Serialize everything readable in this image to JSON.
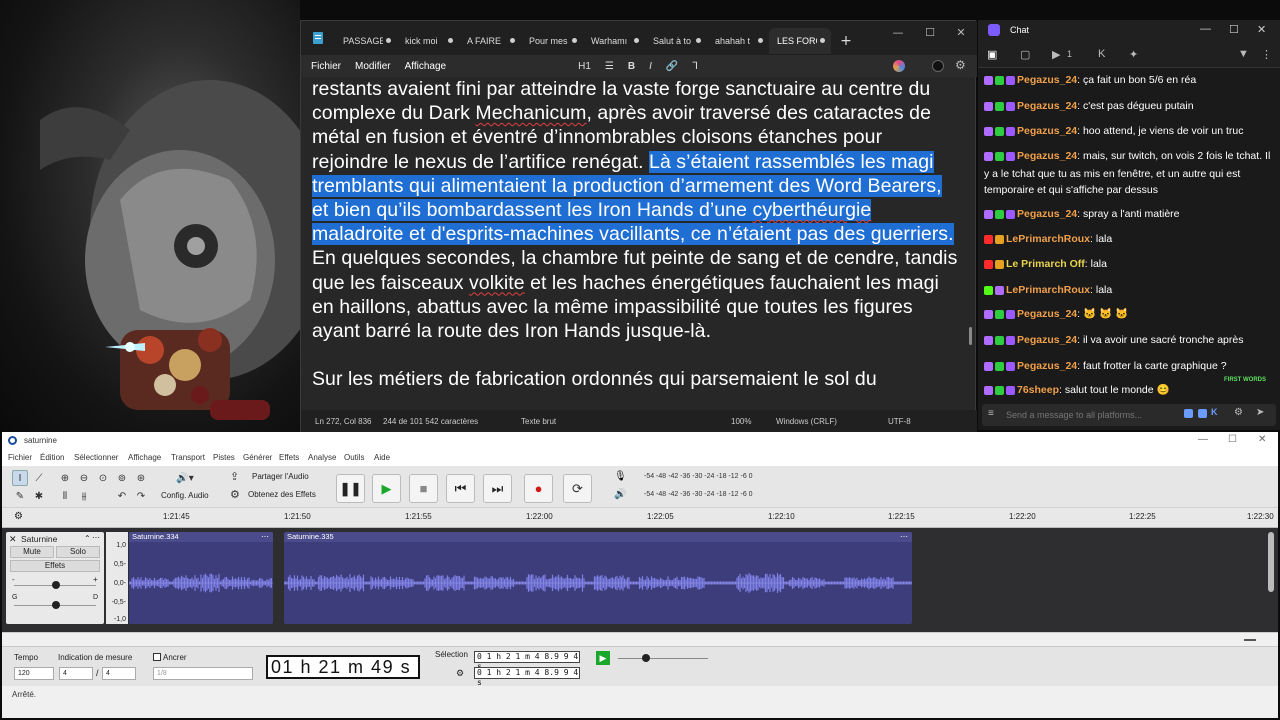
{
  "notepad": {
    "tabs": [
      {
        "label": "PASSAGE"
      },
      {
        "label": "kick moi"
      },
      {
        "label": "A FAIRE"
      },
      {
        "label": "Pour mes"
      },
      {
        "label": "Warhamı"
      },
      {
        "label": "Salut à to"
      },
      {
        "label": "ahahah t"
      },
      {
        "label": "LES FORG"
      }
    ],
    "new_tab": "+",
    "menu": {
      "file": "Fichier",
      "edit": "Modifier",
      "view": "Affichage"
    },
    "format": {
      "heading": "H1",
      "list": "☰",
      "bold": "B",
      "italic": "I",
      "link": "🔗",
      "clear": "Ꞁ"
    },
    "paragraph1": {
      "a": "restants avaient fini par atteindre la vaste forge sanctuaire au centre du complexe du Dark ",
      "a_sq": "Mechanicum",
      "b": ", après avoir traversé des cataractes de métal en fusion et éventré d’innombrables cloisons étanches pour rejoindre le nexus de l’artifice renégat. ",
      "sel1": "Là s’étaient rassemblés les magi tremblants qui alimentaient la production d’armement des Word Bearers, et bien qu’ils bombardassent les Iron Hands d’une ",
      "sel_sq": "cyberthéurgie",
      "sel2": " maladroite et d'esprits-machines vacillants, ce n’étaient pas des guerriers.",
      "c": " En quelques secondes, la chambre fut peinte de sang et de cendre, tandis que les faisceaux ",
      "c_sq": "volkite",
      "d": " et les haches énergétiques fauchaient les magi en haillons, abattus avec la même impassibilité que toutes les figures ayant barré la route des Iron Hands jusque-là."
    },
    "paragraph2": "Sur les métiers de fabrication ordonnés qui parsemaient le sol du",
    "status": {
      "position": "Ln 272, Col 836",
      "chars": "244 de 101 542 caractères",
      "mode": "Texte brut",
      "zoom": "100%",
      "eol": "Windows (CRLF)",
      "encoding": "UTF-8"
    }
  },
  "chat": {
    "title": "Chat",
    "badge_count": "1",
    "first_words": "FIRST WORDS",
    "input_placeholder": "Send a message to all platforms...",
    "messages": [
      {
        "user": "Pegazus_24",
        "text": ": ça fait un bon 5/6 en réa",
        "color": "#f0a04b",
        "platform": "twitch"
      },
      {
        "user": "Pegazus_24",
        "text": ": c'est pas dégueu putain",
        "color": "#f0a04b",
        "platform": "twitch"
      },
      {
        "user": "Pegazus_24",
        "text": ": hoo attend, je viens de voir un truc",
        "color": "#f0a04b",
        "platform": "twitch"
      },
      {
        "user": "Pegazus_24",
        "text": ": mais, sur twitch, on vois 2 fois le tchat. Il y a le tchat que tu as mis en fenêtre, et un autre qui est temporaire et qui s'affiche par dessus",
        "color": "#f0a04b",
        "platform": "twitch"
      },
      {
        "user": "Pegazus_24",
        "text": ": spray a l'anti matière",
        "color": "#f0a04b",
        "platform": "twitch"
      },
      {
        "user": "LePrimarchRoux",
        "text": ": lala",
        "color": "#f0a04b",
        "platform": "youtube"
      },
      {
        "user": "Le Primarch Off",
        "text": ": lala",
        "color": "#e8d44d",
        "platform": "youtube"
      },
      {
        "user": "LePrimarchRoux",
        "text": ": lala",
        "color": "#f0a04b",
        "platform": "kick"
      },
      {
        "user": "Pegazus_24",
        "text": ": ",
        "color": "#f0a04b",
        "platform": "twitch",
        "emotes": "🐱 🐱 🐱"
      },
      {
        "user": "Pegazus_24",
        "text": ": il va avoir une sacré tronche après",
        "color": "#f0a04b",
        "platform": "twitch"
      },
      {
        "user": "Pegazus_24",
        "text": ": faut frotter la carte graphique ?",
        "color": "#f0a04b",
        "platform": "twitch"
      },
      {
        "user": "76sheep",
        "text": ": salut tout le monde ",
        "color": "#f0a04b",
        "platform": "twitch",
        "emotes": "😊"
      }
    ]
  },
  "saturnine": {
    "title": "saturnine",
    "menu": [
      "Fichier",
      "Édition",
      "Sélectionner",
      "Affichage",
      "Transport",
      "Pistes",
      "Générer",
      "Effets",
      "Analyse",
      "Outils",
      "Aide"
    ],
    "audio_config": "Config. Audio",
    "share_audio": "Partager l'Audio",
    "get_effects": "Obtenez des Effets",
    "meter_ticks": "-54 -48 -42 -36 -30 -24 -18 -12 -6 0",
    "ruler": [
      "1:21:45",
      "1:21:50",
      "1:21:55",
      "1:22:00",
      "1:22:05",
      "1:22:10",
      "1:22:15",
      "1:22:20",
      "1:22:25",
      "1:22:30"
    ],
    "track": {
      "name": "Saturnine",
      "mute": "Mute",
      "solo": "Solo",
      "effects": "Effets",
      "pan_left": "G",
      "pan_right": "D",
      "minus": "-",
      "plus": "+"
    },
    "scale": [
      "1,0",
      "0,5-",
      "0,0-",
      "-0,5-",
      "-1,0"
    ],
    "clips": [
      {
        "name": "Saturnine.334"
      },
      {
        "name": "Saturnine.335"
      }
    ],
    "bottom": {
      "tempo_label": "Tempo",
      "tempo_value": "120",
      "measure_label": "Indication de mesure",
      "measure_num": "4",
      "measure_den": "4",
      "snap_label": "Ancrer",
      "snap_value": "1/8",
      "time": "01 h 21 m 49 s",
      "selection_label": "Sélection",
      "sel_start": "0 1 h 2 1 m 4 8.9 9 4 s",
      "sel_end": "0 1 h 2 1 m 4 8.9 9 4 s"
    },
    "status": "Arrêté."
  }
}
